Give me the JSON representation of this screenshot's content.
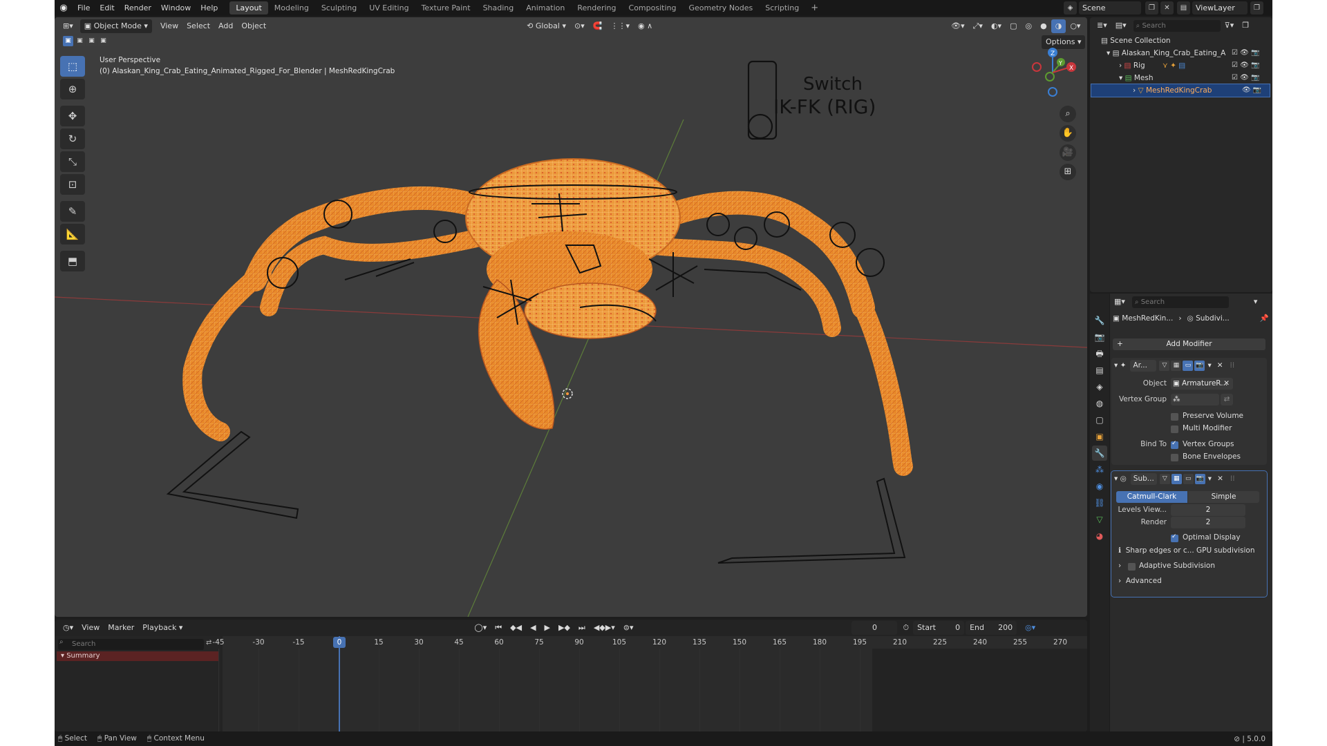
{
  "menus": [
    "File",
    "Edit",
    "Render",
    "Window",
    "Help"
  ],
  "workspaces": [
    "Layout",
    "Modeling",
    "Sculpting",
    "UV Editing",
    "Texture Paint",
    "Shading",
    "Animation",
    "Rendering",
    "Compositing",
    "Geometry Nodes",
    "Scripting"
  ],
  "active_workspace": "Layout",
  "scene": "Scene",
  "view_layer": "ViewLayer",
  "viewport": {
    "mode": "Object Mode",
    "menus": [
      "View",
      "Select",
      "Add",
      "Object"
    ],
    "orientation": "Global",
    "options_label": "Options",
    "perspective": "User Perspective",
    "object_info": "(0) Alaskan_King_Crab_Eating_Animated_Rigged_For_Blender | MeshRedKingCrab",
    "switch_text_1": "Switch",
    "switch_text_2": "IK-FK (RIG)",
    "gizmo_axes": [
      "Z",
      "Y",
      "X"
    ]
  },
  "outliner": {
    "search_placeholder": "Search",
    "scene_collection": "Scene Collection",
    "items": [
      "Alaskan_King_Crab_Eating_A",
      "Rig",
      "Mesh",
      "MeshRedKingCrab"
    ]
  },
  "properties": {
    "search_placeholder": "Search",
    "breadcrumb_object": "MeshRedKin...",
    "breadcrumb_modifier": "Subdivi...",
    "add_modifier": "Add Modifier",
    "armature": {
      "name": "Ar...",
      "object_label": "Object",
      "object_value": "ArmatureR...",
      "vertex_group_label": "Vertex Group",
      "preserve_volume": "Preserve Volume",
      "multi_modifier": "Multi Modifier",
      "bind_to_label": "Bind To",
      "vertex_groups": "Vertex Groups",
      "bone_envelopes": "Bone Envelopes"
    },
    "subdivision": {
      "name": "Sub...",
      "catmull": "Catmull-Clark",
      "simple": "Simple",
      "levels_label": "Levels View...",
      "levels_value": "2",
      "render_label": "Render",
      "render_value": "2",
      "optimal_display": "Optimal Display",
      "info": "Sharp edges or c... GPU subdivision",
      "adaptive": "Adaptive Subdivision",
      "advanced": "Advanced"
    }
  },
  "timeline": {
    "menus": [
      "View",
      "Marker",
      "Playback"
    ],
    "current_frame": "0",
    "start_label": "Start",
    "start_value": "0",
    "end_label": "End",
    "end_value": "200",
    "search_placeholder": "Search",
    "summary": "Summary",
    "frame_labels": [
      "-45",
      "-30",
      "-15",
      "0",
      "15",
      "30",
      "45",
      "60",
      "75",
      "90",
      "105",
      "120",
      "135",
      "150",
      "165",
      "180",
      "195",
      "210",
      "225",
      "240",
      "255",
      "270"
    ]
  },
  "status": {
    "select": "Select",
    "pan_view": "Pan View",
    "context_menu": "Context Menu",
    "version": "5.0.0"
  },
  "colors": {
    "accent": "#4772b3",
    "crab": "#e8892a",
    "x_axis": "#c8363c",
    "y_axis": "#5d9b30",
    "z_axis": "#3a7fd4",
    "selected_object_text": "#ffad5c"
  }
}
